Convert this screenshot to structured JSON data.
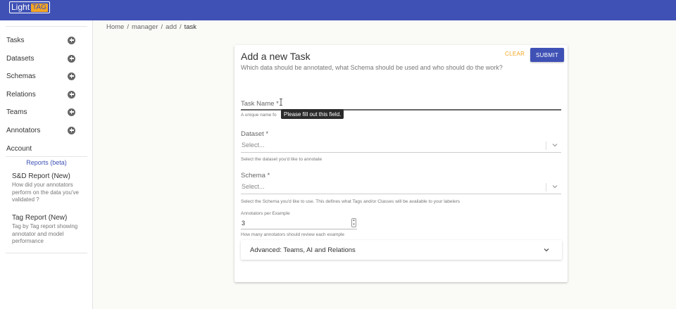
{
  "app": {
    "logo_text": "Light",
    "logo_badge": "TAG"
  },
  "sidebar": {
    "items": [
      {
        "label": "Tasks",
        "icon": "plus-circle-icon"
      },
      {
        "label": "Datasets",
        "icon": "plus-circle-icon"
      },
      {
        "label": "Schemas",
        "icon": "plus-circle-icon"
      },
      {
        "label": "Relations",
        "icon": "plus-circle-icon"
      },
      {
        "label": "Teams",
        "icon": "plus-circle-icon"
      },
      {
        "label": "Annotators",
        "icon": "plus-circle-icon"
      }
    ],
    "account_label": "Account",
    "reports_label": "Reports (beta)",
    "reports": [
      {
        "title": "S&D Report (New)",
        "description": "How did your annotators perform on the data you've validated ?"
      },
      {
        "title": "Tag Report (New)",
        "description": "Tag by Tag report showing annotator and model performance"
      }
    ]
  },
  "breadcrumb": {
    "items": [
      "Home",
      "manager",
      "add"
    ],
    "separator": "/",
    "current": "task"
  },
  "form": {
    "title": "Add a new Task",
    "subtitle": "Which data should be annotated, what Schema should be used and who should do the work?",
    "clear_label": "CLEAR",
    "submit_label": "SUBMIT",
    "task_name": {
      "label": "Task Name *",
      "value": "",
      "helper_visible": "A unique name fo"
    },
    "tooltip": "Please fill out this field.",
    "dataset": {
      "label": "Dataset *",
      "placeholder": "Select...",
      "helper": "Select the dataset you'd like to annotate"
    },
    "schema": {
      "label": "Schema *",
      "placeholder": "Select...",
      "helper": "Select the Schema you'd like to use. This defines what Tags and/or Classes will be available to your labelers"
    },
    "annotators": {
      "label": "Annotators per Example",
      "value": "3",
      "helper": "How many annotators should review each example"
    },
    "advanced_label": "Advanced: Teams, AI and Relations"
  },
  "colors": {
    "primary": "#3f51b5",
    "accent": "#f5a623",
    "background": "#fafaf7"
  }
}
